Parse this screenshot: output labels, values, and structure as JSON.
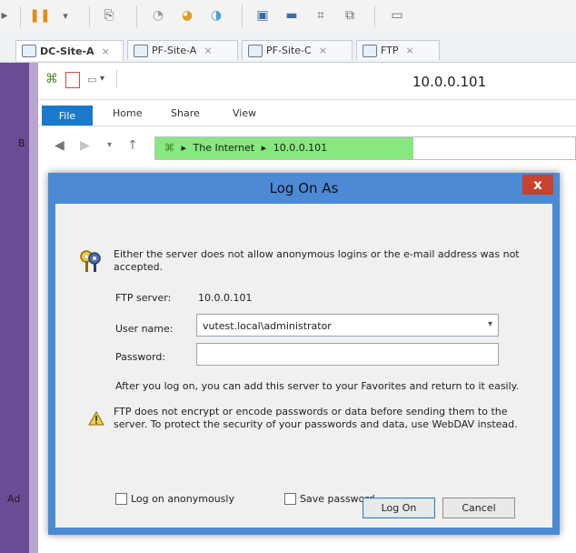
{
  "tabs": [
    "DC-Site-A",
    "PF-Site-A",
    "PF-Site-C",
    "FTP"
  ],
  "explorer": {
    "title": "10.0.0.101",
    "ribbon": {
      "file": "File",
      "home": "Home",
      "share": "Share",
      "view": "View"
    },
    "address": {
      "segment1": "The Internet",
      "segment2": "10.0.0.101"
    }
  },
  "dialog": {
    "title": "Log On As",
    "close_symbol": "x",
    "message": "Either the server does not allow anonymous logins or the e-mail address was not accepted.",
    "ftp_server_label": "FTP server:",
    "ftp_server_value": "10.0.0.101",
    "username_label": "User name:",
    "username_value": "vutest.local\\administrator",
    "password_label": "Password:",
    "password_value": "",
    "favorites_note": "After you log on, you can add this server to your Favorites and return to it easily.",
    "warning_text": "FTP does not encrypt or encode passwords or data before sending them to the server.  To protect the security of your passwords and data, use WebDAV instead.",
    "checkbox_anonymous": "Log on anonymously",
    "checkbox_save": "Save password",
    "logon_button": "Log On",
    "cancel_button": "Cancel"
  },
  "sidebar": {
    "hint_b": "B",
    "hint_ad": "Ad"
  }
}
